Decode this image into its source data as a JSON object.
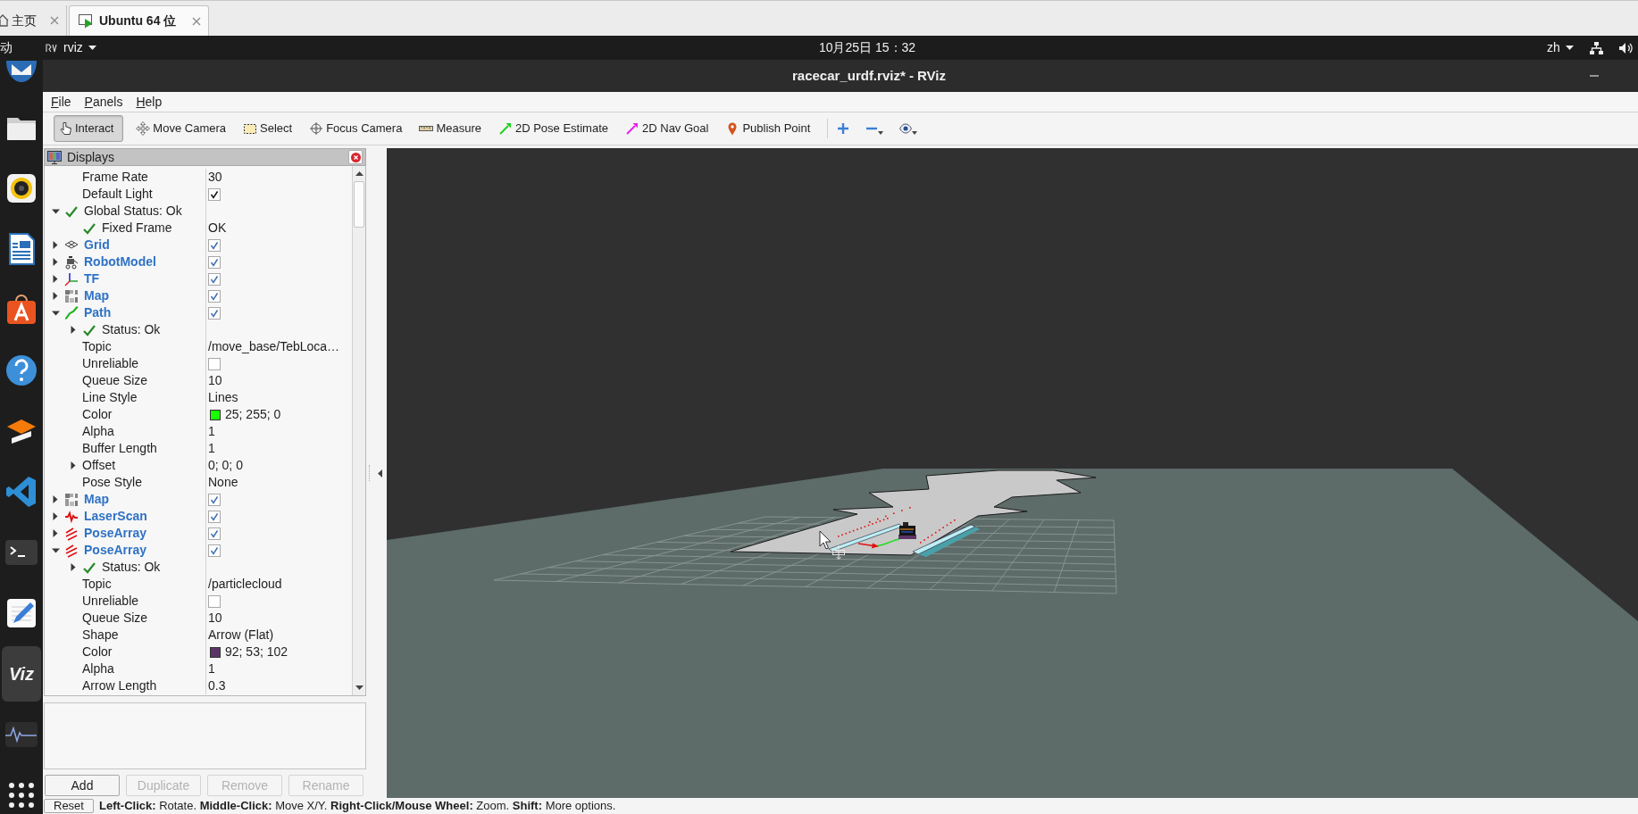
{
  "browser_tabs": [
    {
      "kind": "home",
      "label": "主页",
      "selected": false
    },
    {
      "kind": "vm",
      "label": "Ubuntu 64 位",
      "selected": true
    }
  ],
  "top_bar": {
    "activities": "动",
    "app_menu": "rviz",
    "clock": "10月25日 15：32",
    "input_method": "zh"
  },
  "dock": [
    {
      "kind": "mail",
      "selected": false
    },
    {
      "kind": "files",
      "selected": false
    },
    {
      "kind": "music",
      "selected": false
    },
    {
      "kind": "writer",
      "selected": false
    },
    {
      "kind": "store",
      "selected": false
    },
    {
      "kind": "help",
      "selected": false
    },
    {
      "kind": "layers",
      "selected": false
    },
    {
      "kind": "code",
      "selected": false
    },
    {
      "kind": "terminal",
      "selected": false
    },
    {
      "kind": "text_editor",
      "selected": false
    },
    {
      "kind": "rviz",
      "selected": true,
      "text": "Viz"
    },
    {
      "kind": "monitor",
      "selected": false
    },
    {
      "kind": "apps",
      "selected": false
    }
  ],
  "window": {
    "title": "racecar_urdf.rviz* - RViz"
  },
  "menu": [
    "File",
    "Panels",
    "Help"
  ],
  "toolbar": [
    {
      "kind": "interact",
      "label": "Interact",
      "selected": true
    },
    {
      "kind": "move_camera",
      "label": "Move Camera",
      "selected": false
    },
    {
      "kind": "select",
      "label": "Select",
      "selected": false
    },
    {
      "kind": "focus_camera",
      "label": "Focus Camera",
      "selected": false
    },
    {
      "kind": "measure",
      "label": "Measure",
      "selected": false
    },
    {
      "kind": "pose_estimate",
      "label": "2D Pose Estimate",
      "selected": false
    },
    {
      "kind": "nav_goal",
      "label": "2D Nav Goal",
      "selected": false
    },
    {
      "kind": "publish_point",
      "label": "Publish Point",
      "selected": false
    }
  ],
  "toolbar_actions": [
    {
      "kind": "add",
      "menu": false
    },
    {
      "kind": "remove",
      "menu": true
    },
    {
      "kind": "view",
      "menu": true
    }
  ],
  "displays_panel": {
    "title": "Displays",
    "items": [
      {
        "children": [
          {
            "kind": "text",
            "label": "Frame Rate",
            "value": "30"
          },
          {
            "kind": "checkbox",
            "label": "Default Light",
            "checked": true
          }
        ]
      },
      {
        "kind": "status",
        "label": "Global Status: Ok",
        "expanded": true,
        "children": [
          {
            "kind": "status",
            "label": "Fixed Frame",
            "value": "OK"
          }
        ]
      },
      {
        "kind": "grid",
        "label": "Grid",
        "checked": true,
        "expanded": false
      },
      {
        "kind": "robot_model",
        "label": "RobotModel",
        "checked": true,
        "expanded": false
      },
      {
        "kind": "tf",
        "label": "TF",
        "checked": true,
        "expanded": false
      },
      {
        "kind": "map",
        "label": "Map",
        "checked": true,
        "expanded": false
      },
      {
        "kind": "path",
        "label": "Path",
        "checked": true,
        "expanded": true,
        "children": [
          {
            "kind": "status",
            "label": "Status: Ok",
            "expanded": false
          },
          {
            "kind": "text",
            "label": "Topic",
            "value": "/move_base/TebLoca…"
          },
          {
            "kind": "checkbox",
            "label": "Unreliable",
            "checked": false
          },
          {
            "kind": "text",
            "label": "Queue Size",
            "value": "10"
          },
          {
            "kind": "text",
            "label": "Line Style",
            "value": "Lines"
          },
          {
            "kind": "color",
            "label": "Color",
            "value": "25; 255; 0",
            "color": "#19ff00"
          },
          {
            "kind": "text",
            "label": "Alpha",
            "value": "1"
          },
          {
            "kind": "text",
            "label": "Buffer Length",
            "value": "1"
          },
          {
            "kind": "text",
            "label": "Offset",
            "value": "0; 0; 0",
            "expanded": false
          },
          {
            "kind": "text",
            "label": "Pose Style",
            "value": "None"
          }
        ]
      },
      {
        "kind": "map",
        "label": "Map",
        "checked": true,
        "expanded": false
      },
      {
        "kind": "laser_scan",
        "label": "LaserScan",
        "checked": true,
        "expanded": false
      },
      {
        "kind": "pose_array",
        "label": "PoseArray",
        "checked": true,
        "expanded": false
      },
      {
        "kind": "pose_array",
        "label": "PoseArray",
        "checked": true,
        "expanded": true,
        "children": [
          {
            "kind": "status",
            "label": "Status: Ok",
            "expanded": false
          },
          {
            "kind": "text",
            "label": "Topic",
            "value": "/particlecloud"
          },
          {
            "kind": "checkbox",
            "label": "Unreliable",
            "checked": false
          },
          {
            "kind": "text",
            "label": "Queue Size",
            "value": "10"
          },
          {
            "kind": "text",
            "label": "Shape",
            "value": "Arrow (Flat)"
          },
          {
            "kind": "color",
            "label": "Color",
            "value": "92; 53; 102",
            "color": "#5c3566"
          },
          {
            "kind": "text",
            "label": "Alpha",
            "value": "1"
          },
          {
            "kind": "text",
            "label": "Arrow Length",
            "value": "0.3"
          }
        ]
      }
    ],
    "buttons": [
      {
        "label": "Add",
        "disabled": false
      },
      {
        "label": "Duplicate",
        "disabled": true
      },
      {
        "label": "Remove",
        "disabled": true
      },
      {
        "label": "Rename",
        "disabled": true
      }
    ]
  },
  "status_bar": {
    "reset": "Reset",
    "hint": "**Left-Click:** Rotate. **Middle-Click:** Move X/Y. **Right-Click/Mouse Wheel:** Zoom. **Shift:** More options."
  }
}
